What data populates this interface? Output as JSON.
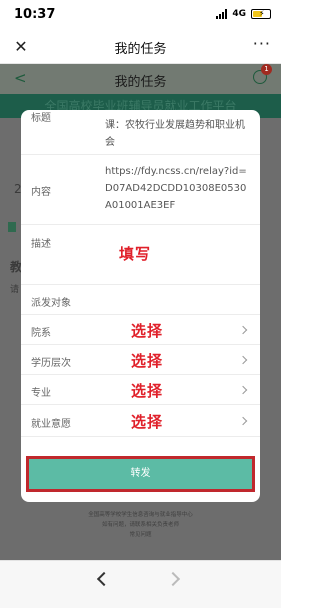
{
  "status": {
    "time": "10:37",
    "network": "4G"
  },
  "wechat_nav": {
    "title": "我的任务"
  },
  "app": {
    "title": "我的任务",
    "badge": "1",
    "banner": "全国高校毕业班辅导员就业工作平台",
    "bg_fragments": {
      "left_2": "2",
      "left_jiao": "教",
      "left_qing": "请"
    },
    "footer_lines": [
      "全国高等学校学生信息咨询与就业指导中心",
      "如有问题，请联系相关负责老师",
      "常见问题"
    ]
  },
  "dialog": {
    "rows": {
      "title": {
        "label": "标题",
        "value": "课：农牧行业发展趋势和职业机会"
      },
      "content": {
        "label": "内容",
        "value": "https://fdy.ncss.cn/relay?id=D07AD42DCDD10308E0530A01001AE3EF"
      },
      "desc": {
        "label": "描述",
        "annotation": "填写"
      },
      "target": {
        "label": "派发对象"
      },
      "department": {
        "label": "院系",
        "annotation": "选择"
      },
      "level": {
        "label": "学历层次",
        "annotation": "选择"
      },
      "major": {
        "label": "专业",
        "annotation": "选择"
      },
      "intention": {
        "label": "就业意愿",
        "annotation": "选择"
      }
    },
    "forward_label": "转发"
  },
  "colors": {
    "accent": "#5cbba5",
    "highlight": "#c0282d",
    "annotation": "#e0202a",
    "banner": "#1d5d4a"
  }
}
